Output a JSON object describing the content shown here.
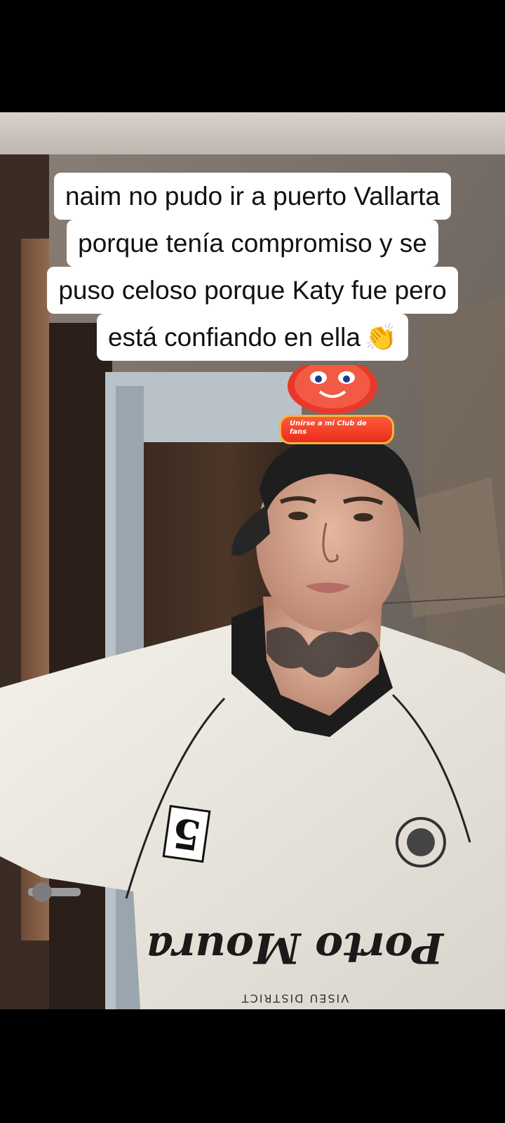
{
  "caption": {
    "lines": [
      "naim no pudo ir a puerto Vallarta",
      "porque tenía compromiso y se",
      "puso celoso porque Katy fue pero",
      "está confiando en ella"
    ],
    "emoji": "👏"
  },
  "overlay": {
    "fan_club_label": "Unirse a mi Club de fans",
    "mascot_icon": "red-mascot-icon"
  },
  "shirt": {
    "number": "5",
    "brand": "Porto Moura",
    "sub": "VISEU DISTRICT"
  },
  "colors": {
    "background": "#000000",
    "caption_bg": "#ffffff",
    "badge_red": "#ea2d1b",
    "badge_border": "#f4b43c"
  }
}
